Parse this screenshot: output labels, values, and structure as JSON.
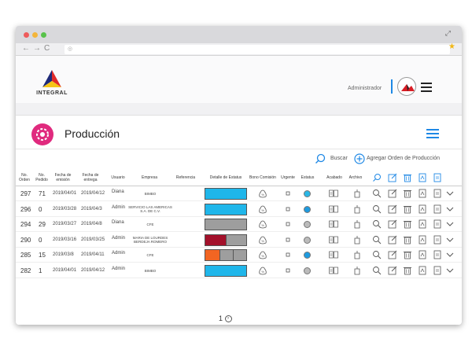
{
  "browser": {
    "url": ""
  },
  "header": {
    "logo_text": "INTEGRAL",
    "user_role": "Administrador"
  },
  "page": {
    "title": "Producción",
    "search_label": "Buscar",
    "add_label": "Agregar Orden de Producción",
    "pager": "1"
  },
  "table": {
    "headers": [
      "No. Orden",
      "No. Pedido",
      "Fecha de emisión",
      "Fecha de entrega",
      "Usuario",
      "Empresa",
      "Referencia",
      "Detalle de Estatus",
      "Bono Comisión",
      "Urgente",
      "Estatus",
      "Acabado",
      "Archivo"
    ],
    "rows": [
      {
        "orden": "297",
        "pedido": "71",
        "emision": "2019/04/01",
        "entrega": "2019/04/12",
        "usuario": "Diana",
        "empresa": "BIMBO",
        "status_color": "#2bb7e6",
        "bar": [
          {
            "color": "#1fb6ea",
            "fraction": 1.0
          }
        ]
      },
      {
        "orden": "296",
        "pedido": "0",
        "emision": "2019/03/28",
        "entrega": "2019/04/3",
        "usuario": "Admin",
        "empresa": "SERVICIO LAS AMERICAS S.A. DE C.V.",
        "status_color": "#1e9be0",
        "bar": [
          {
            "color": "#1fb6ea",
            "fraction": 1.0
          }
        ]
      },
      {
        "orden": "294",
        "pedido": "29",
        "emision": "2019/03/27",
        "entrega": "2019/04/8",
        "usuario": "Diana",
        "empresa": "CFE",
        "status_color": "#bbbbbb",
        "bar": [
          {
            "color": "#9e9e9e",
            "fraction": 1.0
          }
        ]
      },
      {
        "orden": "290",
        "pedido": "0",
        "emision": "2019/03/16",
        "entrega": "2019/03/25",
        "usuario": "Admin",
        "empresa": "MARIA DE LOURDES BERDEJA ROMERO",
        "status_color": "#bbbbbb",
        "bar": [
          {
            "color": "#a3102a",
            "fraction": 0.5
          },
          {
            "color": "#9e9e9e",
            "fraction": 0.5
          }
        ]
      },
      {
        "orden": "285",
        "pedido": "15",
        "emision": "2019/03/8",
        "entrega": "2019/04/11",
        "usuario": "Admin",
        "empresa": "CFE",
        "status_color": "#1e9be0",
        "bar": [
          {
            "color": "#f26522",
            "fraction": 0.34
          },
          {
            "color": "#9e9e9e",
            "fraction": 0.33
          },
          {
            "color": "#9e9e9e",
            "fraction": 0.33
          }
        ]
      },
      {
        "orden": "282",
        "pedido": "1",
        "emision": "2019/04/01",
        "entrega": "2019/04/12",
        "usuario": "Admin",
        "empresa": "BIMBO",
        "status_color": "#bbbbbb",
        "bar": [
          {
            "color": "#1fb6ea",
            "fraction": 1.0
          }
        ]
      }
    ]
  },
  "icons": [
    "search-icon",
    "add-circle-icon",
    "edit-icon",
    "trash-icon",
    "pdf-icon",
    "document-icon",
    "chevron-down-icon",
    "hamburger-icon",
    "money-bag-icon"
  ],
  "colors": {
    "accent": "#1e88e5",
    "brand_pink": "#e02a7e"
  }
}
